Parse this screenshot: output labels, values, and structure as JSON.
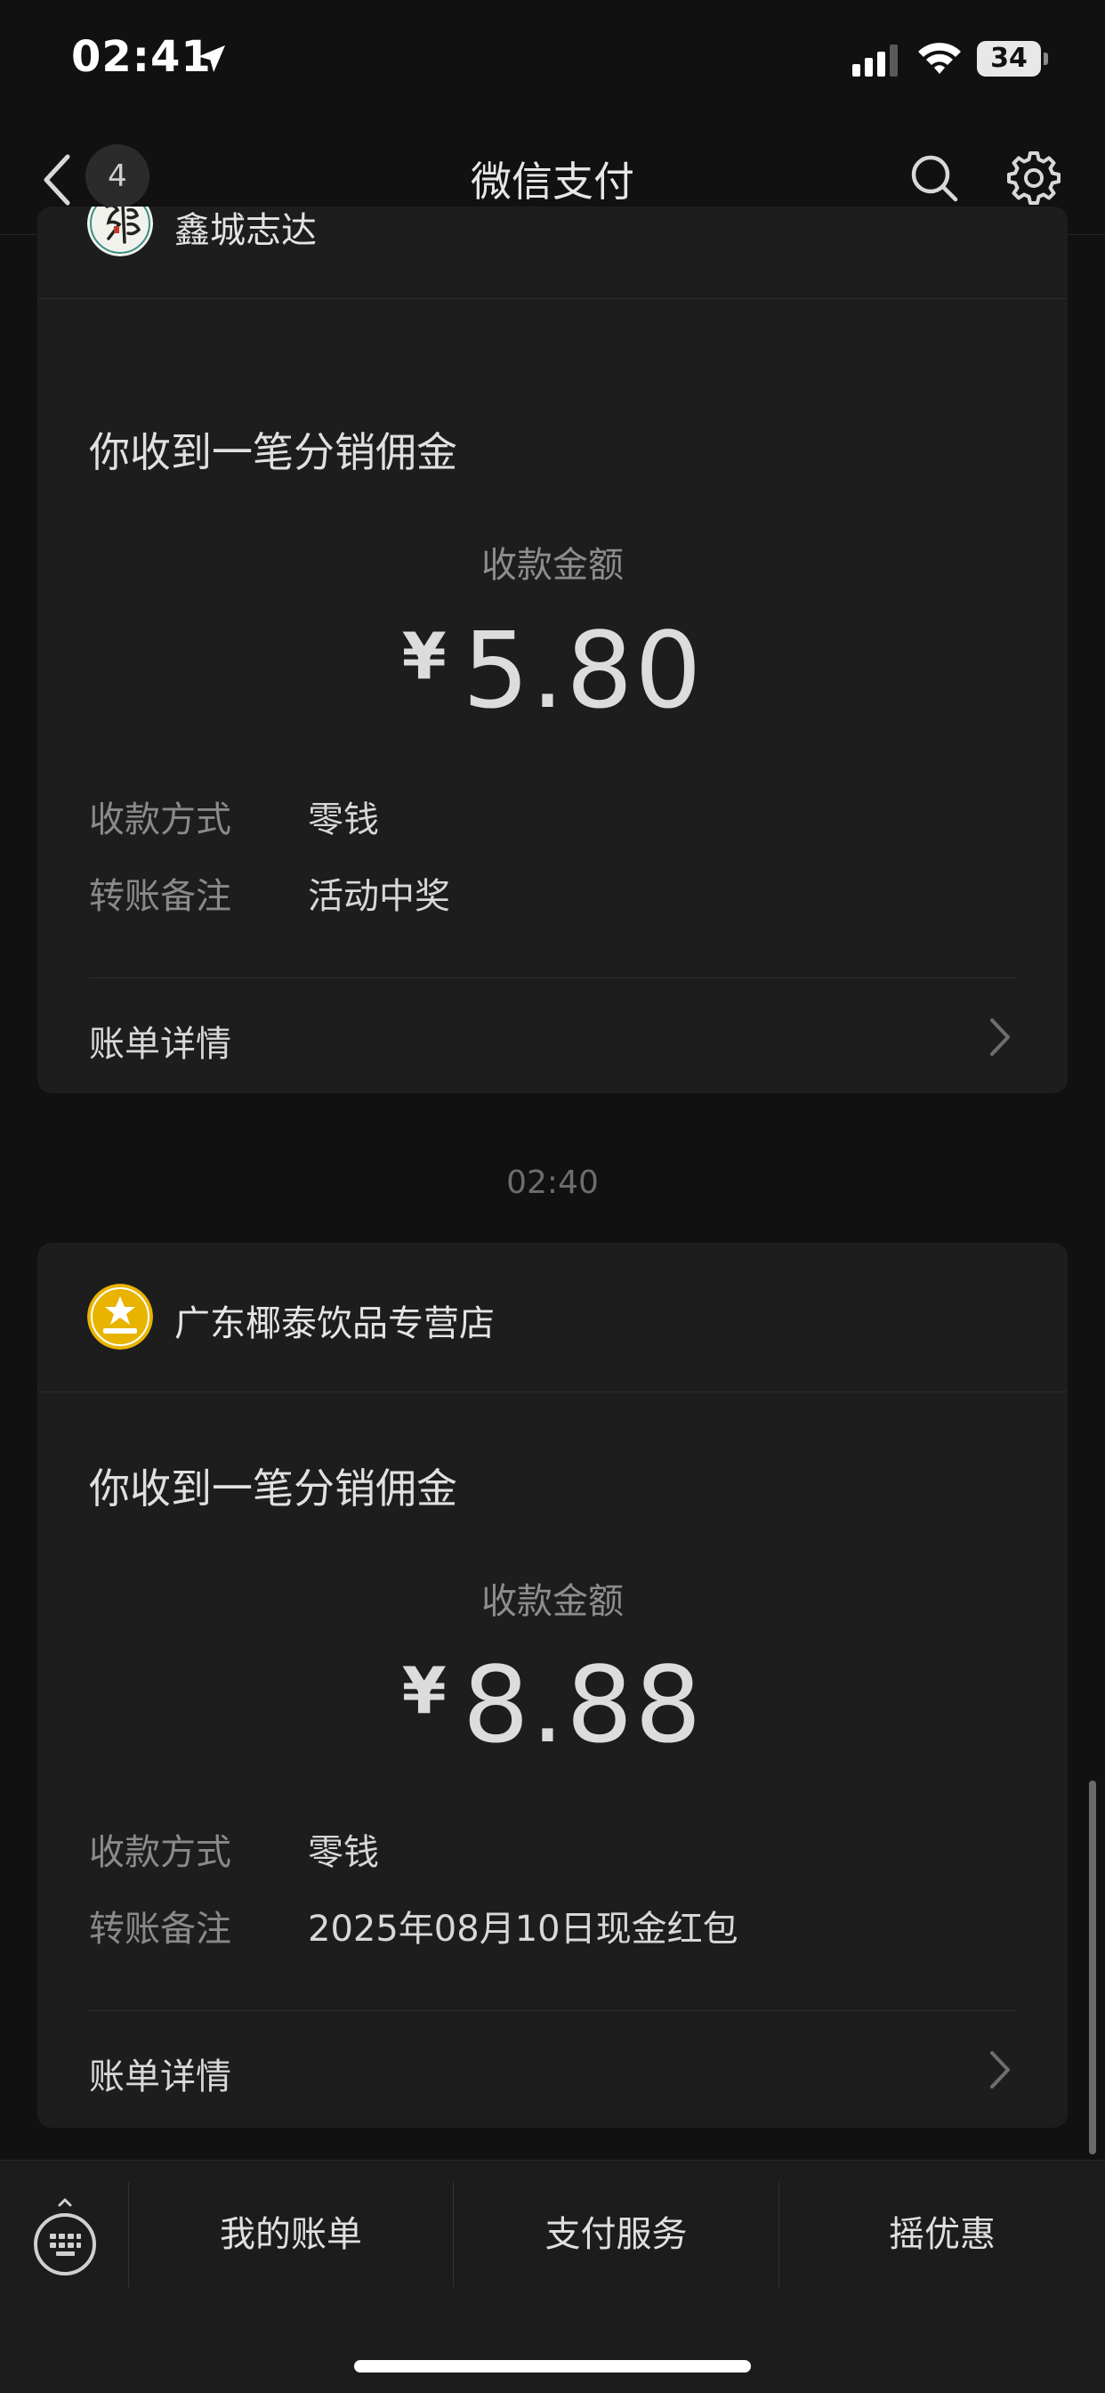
{
  "status_bar": {
    "time": "02:41",
    "battery": "34"
  },
  "nav": {
    "unread_count": "4",
    "title": "微信支付"
  },
  "cards": [
    {
      "merchant": "鑫城志达",
      "title": "你收到一笔分销佣金",
      "amount_label": "收款金额",
      "currency": "¥",
      "amount": "5.80",
      "rows": [
        {
          "label": "收款方式",
          "value": "零钱"
        },
        {
          "label": "转账备注",
          "value": "活动中奖"
        }
      ],
      "detail_label": "账单详情"
    },
    {
      "merchant": "广东椰泰饮品专营店",
      "title": "你收到一笔分销佣金",
      "amount_label": "收款金额",
      "currency": "¥",
      "amount": "8.88",
      "rows": [
        {
          "label": "收款方式",
          "value": "零钱"
        },
        {
          "label": "转账备注",
          "value": "2025年08月10日现金红包"
        }
      ],
      "detail_label": "账单详情"
    }
  ],
  "timestamp": "02:40",
  "bottom_menu": [
    {
      "label": "我的账单"
    },
    {
      "label": "支付服务"
    },
    {
      "label": "摇优惠"
    }
  ],
  "colors": {
    "background": "#111111",
    "card": "#1d1d1d",
    "bottom_bar": "#1c1c1c",
    "logo_gold": "#e8b400"
  },
  "icons": [
    "location-arrow-icon",
    "cellular-signal-icon",
    "wifi-icon",
    "back-chevron-icon",
    "search-icon",
    "gear-icon",
    "chevron-right-icon",
    "keyboard-icon"
  ]
}
